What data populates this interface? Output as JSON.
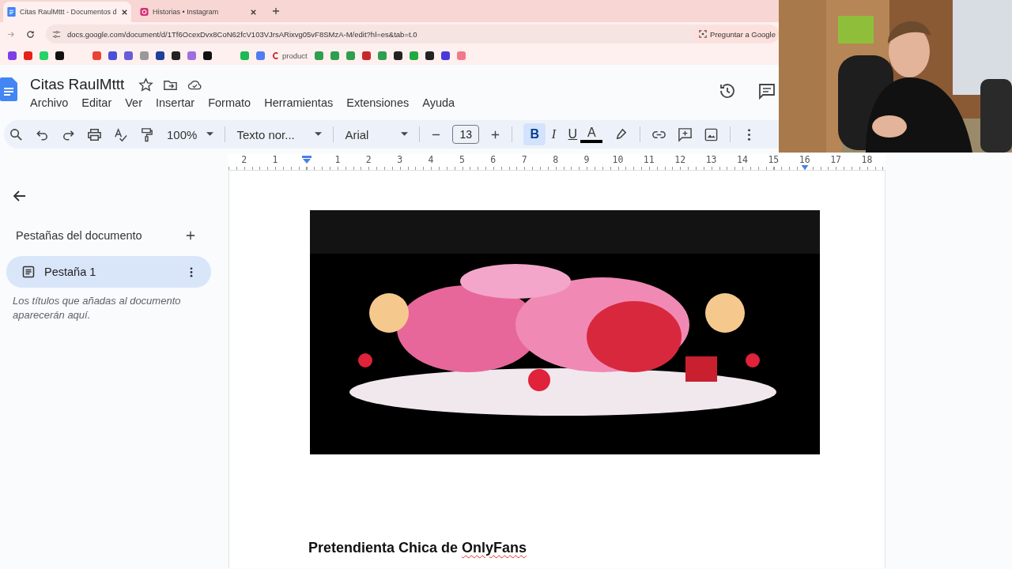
{
  "browser": {
    "tabs": [
      {
        "title": "Citas RaulMttt - Documentos d",
        "selected": true,
        "kind": "docs"
      },
      {
        "title": "Historias • Instagram",
        "selected": false,
        "kind": "instagram"
      }
    ],
    "url": "docs.google.com/document/d/1Tf6OcexDvx8CoN62fcV103VJrsARixvg05vF8SMzA-M/edit?hl=es&tab=t.0",
    "ask_button": "Preguntar a Google",
    "bookmark_label": "product"
  },
  "document": {
    "title": "Citas RaulMttt",
    "menu": [
      "Archivo",
      "Editar",
      "Ver",
      "Insertar",
      "Formato",
      "Herramientas",
      "Extensiones",
      "Ayuda"
    ]
  },
  "toolbar": {
    "zoom": "100%",
    "style": "Texto nor...",
    "font": "Arial",
    "font_size": "13",
    "format_buttons": [
      {
        "label": "B",
        "kind": "bold",
        "selected": true
      },
      {
        "label": "I",
        "kind": "italic",
        "selected": false
      },
      {
        "label": "U",
        "kind": "underline",
        "selected": false
      },
      {
        "label": "A",
        "kind": "text-color",
        "selected": false
      }
    ]
  },
  "ruler": {
    "left_labels": [
      "2",
      "1"
    ],
    "right_labels": [
      "1",
      "2",
      "3",
      "4",
      "5",
      "6",
      "7",
      "8",
      "9",
      "10",
      "11",
      "12",
      "13",
      "14",
      "15",
      "16",
      "17",
      "18"
    ]
  },
  "sidebar": {
    "heading": "Pestañas del documento",
    "tabs": [
      {
        "label": "Pestaña 1",
        "selected": true
      }
    ],
    "hint": "Los títulos que añadas al documento aparecerán aquí."
  },
  "page": {
    "heading_parts": [
      {
        "text": "Pretendienta Chica de ",
        "misspelled": false
      },
      {
        "text": "OnlyFans",
        "misspelled": true
      }
    ]
  }
}
